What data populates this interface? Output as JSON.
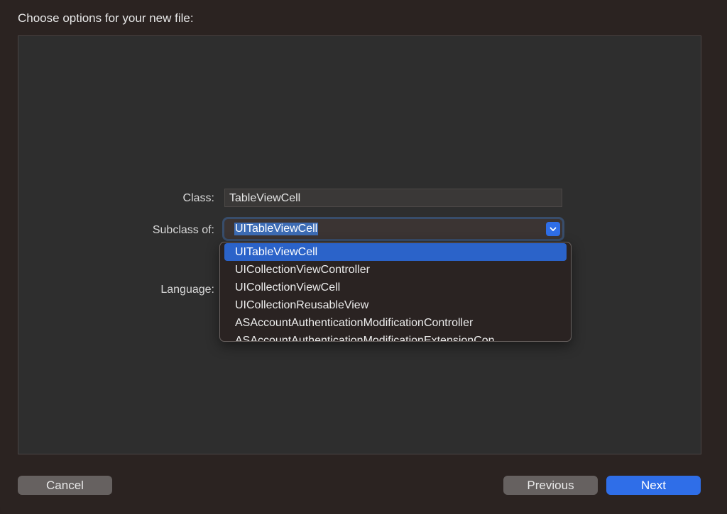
{
  "header": {
    "title": "Choose options for your new file:"
  },
  "form": {
    "class_label": "Class:",
    "class_value": "TableViewCell",
    "subclass_label": "Subclass of:",
    "subclass_value": "UITableViewCell",
    "language_label": "Language:"
  },
  "dropdown": {
    "items": [
      {
        "label": "UITableViewCell",
        "selected": true
      },
      {
        "label": "UICollectionViewController"
      },
      {
        "label": "UICollectionViewCell"
      },
      {
        "label": "UICollectionReusableView"
      },
      {
        "label": "ASAccountAuthenticationModificationController"
      },
      {
        "label": "ASAccountAuthenticationModificationExtensionCon"
      }
    ]
  },
  "footer": {
    "cancel_label": "Cancel",
    "previous_label": "Previous",
    "next_label": "Next"
  },
  "colors": {
    "accent": "#2f6ee8",
    "selection": "#2b63c9",
    "background": "#2b2321"
  },
  "icons": {
    "dropdown_toggle": "chevron-down-icon"
  }
}
